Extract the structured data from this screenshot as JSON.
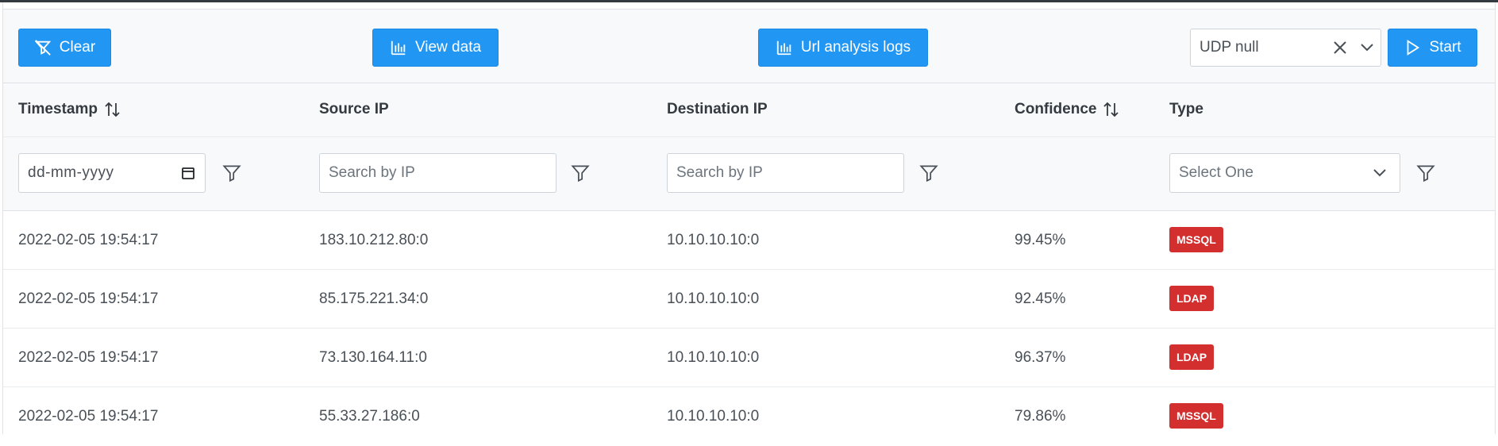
{
  "toolbar": {
    "clear_label": "Clear",
    "view_data_label": "View data",
    "url_logs_label": "Url analysis logs",
    "protocol_select_value": "UDP null",
    "start_label": "Start"
  },
  "columns": {
    "timestamp": "Timestamp",
    "source_ip": "Source IP",
    "destination_ip": "Destination IP",
    "confidence": "Confidence",
    "type": "Type"
  },
  "filters": {
    "date_placeholder": "dd-mm-yyyy",
    "source_placeholder": "Search by IP",
    "destination_placeholder": "Search by IP",
    "type_placeholder": "Select One"
  },
  "rows": [
    {
      "timestamp": "2022-02-05 19:54:17",
      "source_ip": "183.10.212.80:0",
      "destination_ip": "10.10.10.10:0",
      "confidence": "99.45%",
      "type": "MSSQL"
    },
    {
      "timestamp": "2022-02-05 19:54:17",
      "source_ip": "85.175.221.34:0",
      "destination_ip": "10.10.10.10:0",
      "confidence": "92.45%",
      "type": "LDAP"
    },
    {
      "timestamp": "2022-02-05 19:54:17",
      "source_ip": "73.130.164.11:0",
      "destination_ip": "10.10.10.10:0",
      "confidence": "96.37%",
      "type": "LDAP"
    },
    {
      "timestamp": "2022-02-05 19:54:17",
      "source_ip": "55.33.27.186:0",
      "destination_ip": "10.10.10.10:0",
      "confidence": "79.86%",
      "type": "MSSQL"
    }
  ],
  "colors": {
    "primary": "#2196f3",
    "badge": "#d32f2f"
  },
  "icons": {
    "clear": "filter-slash-icon",
    "view_data": "chart-bar-icon",
    "url_logs": "chart-bar-icon",
    "start": "play-icon",
    "sort": "sort-icon",
    "filter": "filter-icon",
    "calendar": "calendar-icon",
    "close": "close-icon",
    "chevron": "chevron-down-icon"
  }
}
